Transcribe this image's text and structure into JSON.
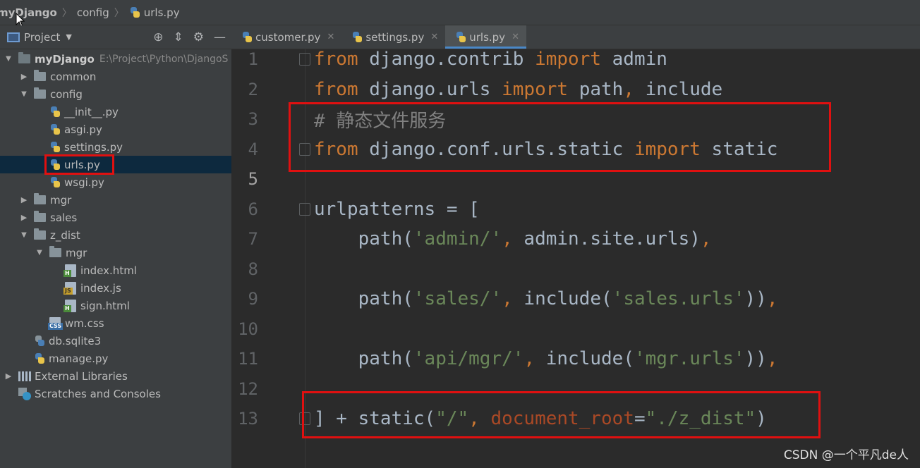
{
  "breadcrumb": {
    "root": "myDjango",
    "folder": "config",
    "file": "urls.py"
  },
  "project_toolbar": {
    "label": "Project"
  },
  "tree": [
    {
      "depth": 0,
      "arrow": "down",
      "icon": "folder-dark",
      "label": "myDjango",
      "path": "E:\\Project\\Python\\DjangoS",
      "bold": true
    },
    {
      "depth": 1,
      "arrow": "right",
      "icon": "folder",
      "label": "common"
    },
    {
      "depth": 1,
      "arrow": "down",
      "icon": "folder",
      "label": "config"
    },
    {
      "depth": 2,
      "arrow": "none",
      "icon": "python",
      "label": "__init__.py"
    },
    {
      "depth": 2,
      "arrow": "none",
      "icon": "python",
      "label": "asgi.py"
    },
    {
      "depth": 2,
      "arrow": "none",
      "icon": "python",
      "label": "settings.py"
    },
    {
      "depth": 2,
      "arrow": "none",
      "icon": "python",
      "label": "urls.py",
      "selected": true
    },
    {
      "depth": 2,
      "arrow": "none",
      "icon": "python",
      "label": "wsgi.py"
    },
    {
      "depth": 1,
      "arrow": "right",
      "icon": "folder",
      "label": "mgr"
    },
    {
      "depth": 1,
      "arrow": "right",
      "icon": "folder",
      "label": "sales"
    },
    {
      "depth": 1,
      "arrow": "down",
      "icon": "folder",
      "label": "z_dist"
    },
    {
      "depth": 2,
      "arrow": "down",
      "icon": "folder",
      "label": "mgr"
    },
    {
      "depth": 3,
      "arrow": "none",
      "icon": "html",
      "label": "index.html"
    },
    {
      "depth": 3,
      "arrow": "none",
      "icon": "js",
      "label": "index.js"
    },
    {
      "depth": 3,
      "arrow": "none",
      "icon": "html",
      "label": "sign.html"
    },
    {
      "depth": 2,
      "arrow": "none",
      "icon": "css",
      "label": "wm.css"
    },
    {
      "depth": 1,
      "arrow": "none",
      "icon": "db",
      "label": "db.sqlite3"
    },
    {
      "depth": 1,
      "arrow": "none",
      "icon": "python",
      "label": "manage.py"
    },
    {
      "depth": 0,
      "arrow": "right",
      "icon": "library",
      "label": "External Libraries"
    },
    {
      "depth": 0,
      "arrow": "none",
      "icon": "scratch",
      "label": "Scratches and Consoles"
    }
  ],
  "tabs": [
    {
      "label": "customer.py",
      "close": "✕",
      "active": false
    },
    {
      "label": "settings.py",
      "close": "✕",
      "active": false
    },
    {
      "label": "urls.py",
      "close": "✕",
      "active": true
    }
  ],
  "code_lines": [
    {
      "n": "1",
      "fold": true,
      "tokens": [
        [
          "kw",
          "from"
        ],
        [
          "id",
          " django.contrib "
        ],
        [
          "kw",
          "import"
        ],
        [
          "id",
          " admin"
        ]
      ]
    },
    {
      "n": "2",
      "tokens": [
        [
          "kw",
          "from"
        ],
        [
          "id",
          " django.urls "
        ],
        [
          "kw",
          "import"
        ],
        [
          "id",
          " path"
        ],
        [
          "pn",
          ","
        ],
        [
          "id",
          " include"
        ]
      ]
    },
    {
      "n": "3",
      "tokens": [
        [
          "cmt",
          "# 静态文件服务"
        ]
      ]
    },
    {
      "n": "4",
      "fold": true,
      "tokens": [
        [
          "kw",
          "from"
        ],
        [
          "id",
          " django.conf.urls.static "
        ],
        [
          "kw",
          "import"
        ],
        [
          "id",
          " static"
        ]
      ]
    },
    {
      "n": "5",
      "current": true,
      "tokens": []
    },
    {
      "n": "6",
      "fold": true,
      "tokens": [
        [
          "id",
          "urlpatterns = ["
        ]
      ]
    },
    {
      "n": "7",
      "tokens": [
        [
          "id",
          "    path("
        ],
        [
          "str",
          "'admin/'"
        ],
        [
          "pn",
          ","
        ],
        [
          "id",
          " admin.site.urls)"
        ],
        [
          "pn",
          ","
        ]
      ]
    },
    {
      "n": "8",
      "tokens": []
    },
    {
      "n": "9",
      "tokens": [
        [
          "id",
          "    path("
        ],
        [
          "str",
          "'sales/'"
        ],
        [
          "pn",
          ","
        ],
        [
          "id",
          " include("
        ],
        [
          "str",
          "'sales.urls'"
        ],
        [
          "id",
          "))"
        ],
        [
          "pn",
          ","
        ]
      ]
    },
    {
      "n": "10",
      "tokens": []
    },
    {
      "n": "11",
      "tokens": [
        [
          "id",
          "    path("
        ],
        [
          "str",
          "'api/mgr/'"
        ],
        [
          "pn",
          ","
        ],
        [
          "id",
          " include("
        ],
        [
          "str",
          "'mgr.urls'"
        ],
        [
          "id",
          "))"
        ],
        [
          "pn",
          ","
        ]
      ]
    },
    {
      "n": "12",
      "tokens": []
    },
    {
      "n": "13",
      "fold": true,
      "tokens": [
        [
          "id",
          "] + static("
        ],
        [
          "str",
          "\"/\""
        ],
        [
          "pn",
          ","
        ],
        [
          "id",
          " "
        ],
        [
          "param",
          "document_root"
        ],
        [
          "id",
          "="
        ],
        [
          "str",
          "\"./z_dist\""
        ],
        [
          "id",
          ")"
        ]
      ]
    }
  ],
  "watermark": "CSDN @一个平凡de人",
  "colors": {
    "highlight_box": "#e01010",
    "keyword": "#cc7832",
    "string": "#6a8759",
    "comment": "#808080",
    "param": "#aa4926"
  }
}
